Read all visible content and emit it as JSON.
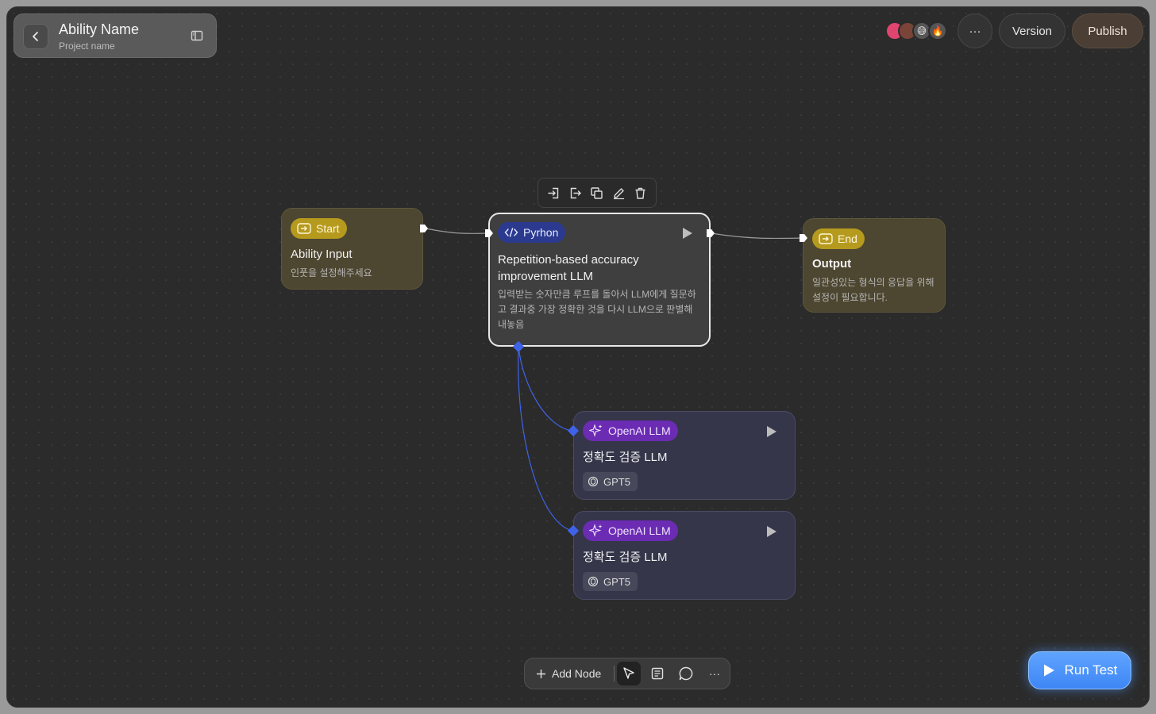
{
  "header": {
    "title": "Ability Name",
    "subtitle": "Project name"
  },
  "topbar": {
    "more_label": "···",
    "version_label": "Version",
    "publish_label": "Publish",
    "avatar_emojis": [
      "😅",
      "🔥"
    ]
  },
  "nodes": {
    "start": {
      "badge": "Start",
      "title": "Ability Input",
      "desc": "인풋을 설정해주세요"
    },
    "python": {
      "badge": "Pyrhon",
      "title": "Repetition-based accuracy improvement LLM",
      "desc": "입력받는 숫자만큼 루프를 돌아서 LLM에게 질문하고 결과중 가장 정확한 것을 다시 LLM으로 판별해 내놓음"
    },
    "end": {
      "badge": "End",
      "title": "Output",
      "desc": "일관성있는 형식의 응답을 위해 설정이 필요합니다."
    },
    "llm_1": {
      "badge": "OpenAI LLM",
      "title": "정확도 검증 LLM",
      "model": "GPT5"
    },
    "llm_2": {
      "badge": "OpenAI LLM",
      "title": "정확도 검증 LLM",
      "model": "GPT5"
    }
  },
  "bottom_toolbar": {
    "add_node_label": "Add Node",
    "more_label": "···"
  },
  "run_test_label": "Run Test",
  "colors": {
    "canvas": "#2b2b2b",
    "start_end_badge": "#b59a1e",
    "python_badge": "#2b3a8f",
    "llm_badge": "#6b2bb3",
    "connector": "#3f63e8",
    "run_test": "#4a90f7"
  }
}
